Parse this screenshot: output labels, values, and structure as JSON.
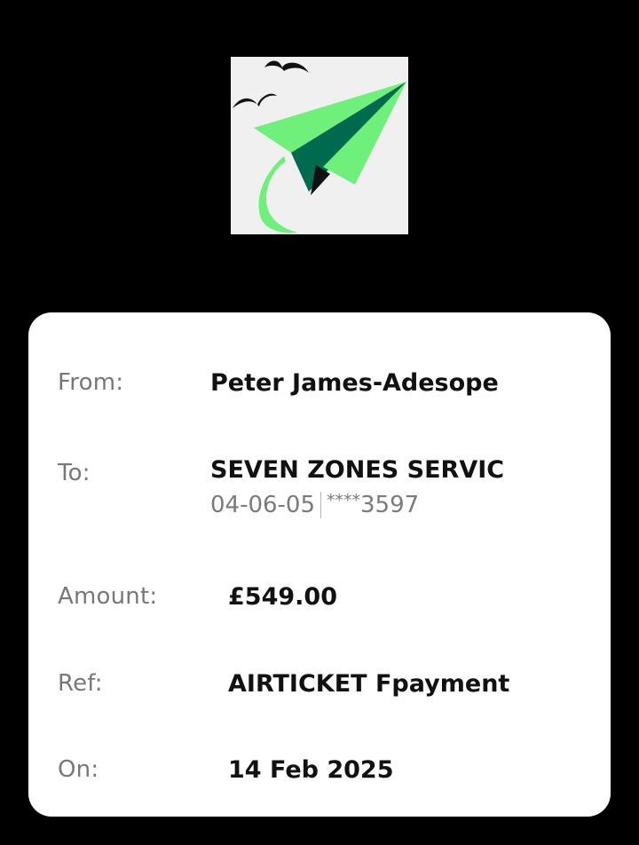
{
  "logo": {
    "icon": "paper-plane-logo",
    "background": "#f0f0f0",
    "accent": "#6ef07a",
    "accent_dark": "#006a4e"
  },
  "details": {
    "from": {
      "label": "From:",
      "value": "Peter James-Adesope"
    },
    "to": {
      "label": "To:",
      "value": "SEVEN ZONES SERVIC",
      "sort_code": "04-06-05",
      "account_mask": "****",
      "account_last4": "3597"
    },
    "amount": {
      "label": "Amount:",
      "value": "£549.00"
    },
    "ref": {
      "label": "Ref:",
      "value": "AIRTICKET Fpayment"
    },
    "on": {
      "label": "On:",
      "value": "14 Feb 2025"
    }
  }
}
